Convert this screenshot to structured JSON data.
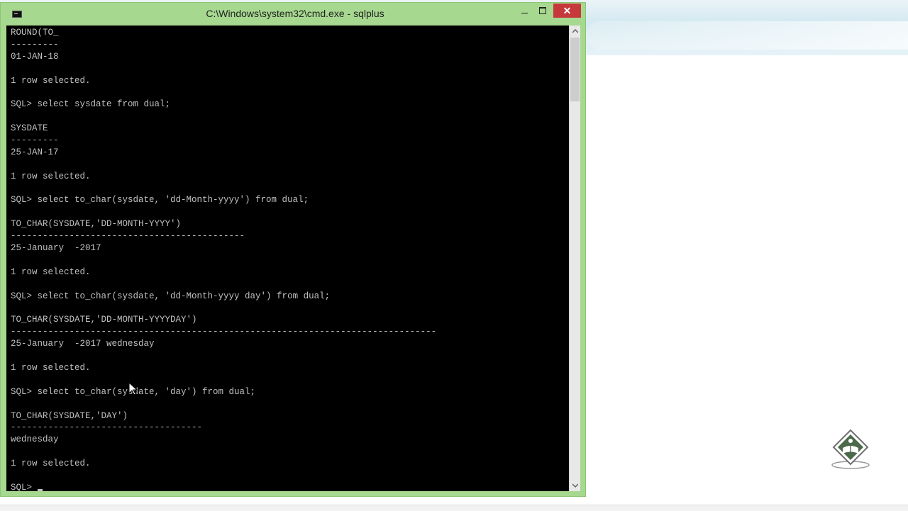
{
  "window": {
    "title": "C:\\Windows\\system32\\cmd.exe - sqlplus",
    "close_label": "✕"
  },
  "console": {
    "lines": [
      "ROUND(TO_",
      "---------",
      "01-JAN-18",
      "",
      "1 row selected.",
      "",
      "SQL> select sysdate from dual;",
      "",
      "SYSDATE",
      "---------",
      "25-JAN-17",
      "",
      "1 row selected.",
      "",
      "SQL> select to_char(sysdate, 'dd-Month-yyyy') from dual;",
      "",
      "TO_CHAR(SYSDATE,'DD-MONTH-YYYY')",
      "--------------------------------------------",
      "25-January  -2017",
      "",
      "1 row selected.",
      "",
      "SQL> select to_char(sysdate, 'dd-Month-yyyy day') from dual;",
      "",
      "TO_CHAR(SYSDATE,'DD-MONTH-YYYYDAY')",
      "--------------------------------------------------------------------------------",
      "25-January  -2017 wednesday",
      "",
      "1 row selected.",
      "",
      "SQL> select to_char(sysdate, 'day') from dual;",
      "",
      "TO_CHAR(SYSDATE,'DAY')",
      "------------------------------------",
      "wednesday",
      "",
      "1 row selected.",
      ""
    ],
    "prompt": "SQL> "
  },
  "colors": {
    "window_frame": "#a6d88f",
    "console_bg": "#000000",
    "console_text": "#c0c0c0",
    "close_button": "#c7383a"
  },
  "icons": {
    "app": "cmd-icon",
    "minimize": "minimize-icon",
    "maximize": "maximize-icon",
    "close": "close-icon",
    "scroll_up": "chevron-up-icon",
    "scroll_down": "chevron-down-icon",
    "pointer": "mouse-pointer-icon",
    "logo": "book-logo-icon"
  }
}
